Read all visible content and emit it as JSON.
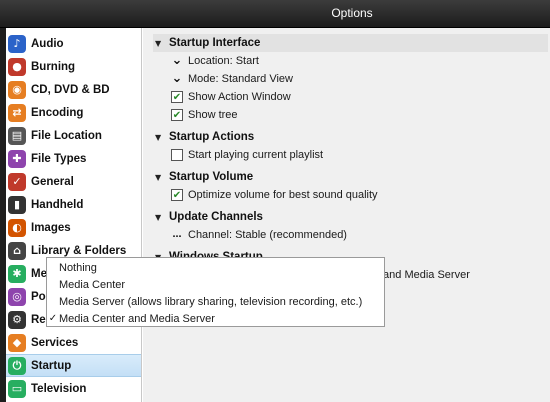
{
  "window": {
    "title": "Options"
  },
  "sidebar": {
    "items": [
      {
        "label": "Audio",
        "icon": "music-note-icon",
        "glyph": "♪",
        "color": "#2b63c9"
      },
      {
        "label": "Burning",
        "icon": "disc-burn-icon",
        "glyph": "●",
        "color": "#c0392b"
      },
      {
        "label": "CD, DVD & BD",
        "icon": "cd-icon",
        "glyph": "◉",
        "color": "#e67e22"
      },
      {
        "label": "Encoding",
        "icon": "encoding-icon",
        "glyph": "⇄",
        "color": "#e67e22"
      },
      {
        "label": "File Location",
        "icon": "file-location-icon",
        "glyph": "▤",
        "color": "#555555"
      },
      {
        "label": "File Types",
        "icon": "puzzle-icon",
        "glyph": "✚",
        "color": "#8e44ad"
      },
      {
        "label": "General",
        "icon": "general-icon",
        "glyph": "✓",
        "color": "#c0392b"
      },
      {
        "label": "Handheld",
        "icon": "handheld-icon",
        "glyph": "▮",
        "color": "#333333"
      },
      {
        "label": "Images",
        "icon": "images-icon",
        "glyph": "◐",
        "color": "#d35400"
      },
      {
        "label": "Library & Folders",
        "icon": "library-icon",
        "glyph": "⌂",
        "color": "#444444"
      },
      {
        "label": "Media Network",
        "icon": "network-icon",
        "glyph": "✱",
        "color": "#27ae60"
      },
      {
        "label": "Podcast",
        "icon": "podcast-icon",
        "glyph": "◎",
        "color": "#8e44ad"
      },
      {
        "label": "Remote Control",
        "icon": "remote-icon",
        "glyph": "⚙",
        "color": "#333333"
      },
      {
        "label": "Services",
        "icon": "services-icon",
        "glyph": "◆",
        "color": "#e67e22"
      },
      {
        "label": "Startup",
        "icon": "power-icon",
        "glyph": "⏻",
        "color": "#27ae60",
        "selected": true
      },
      {
        "label": "Television",
        "icon": "television-icon",
        "glyph": "▭",
        "color": "#27ae60"
      }
    ]
  },
  "main": {
    "sections": [
      {
        "title": "Startup Interface",
        "rows": [
          {
            "type": "chevron",
            "label": "Location: Start"
          },
          {
            "type": "chevron",
            "label": "Mode: Standard View"
          },
          {
            "type": "checkbox",
            "checked": true,
            "label": "Show Action Window"
          },
          {
            "type": "checkbox",
            "checked": true,
            "label": "Show tree"
          }
        ]
      },
      {
        "title": "Startup Actions",
        "rows": [
          {
            "type": "checkbox",
            "checked": false,
            "label": "Start playing current playlist"
          }
        ]
      },
      {
        "title": "Startup Volume",
        "rows": [
          {
            "type": "checkbox",
            "checked": true,
            "label": "Optimize volume for best sound quality"
          }
        ]
      },
      {
        "title": "Update Channels",
        "rows": [
          {
            "type": "ellipsis",
            "label": "Channel: Stable (recommended)"
          }
        ]
      },
      {
        "title": "Windows Startup",
        "rows": [
          {
            "type": "chevron",
            "label": "Run on Windows startup: Media Center and Media Server"
          }
        ]
      }
    ],
    "dropdown": {
      "options": [
        {
          "label": "Nothing",
          "checked": false
        },
        {
          "label": "Media Center",
          "checked": false
        },
        {
          "label": "Media Server (allows library sharing, television recording, etc.)",
          "checked": false
        },
        {
          "label": "Media Center and Media Server",
          "checked": true
        }
      ]
    }
  }
}
